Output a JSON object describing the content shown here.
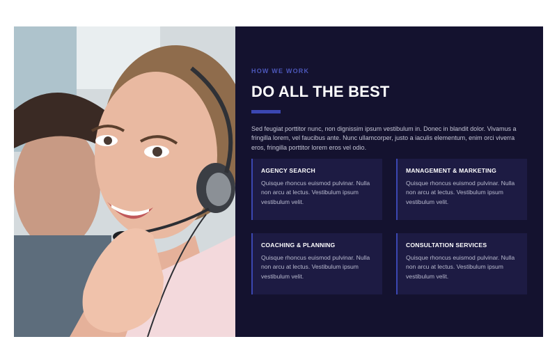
{
  "section": {
    "eyebrow": "HOW WE WORK",
    "title": "DO ALL THE BEST",
    "intro": "Sed feugiat porttitor nunc, non dignissim ipsum vestibulum in. Donec in blandit dolor. Vivamus a fringilla lorem, vel faucibus ante. Nunc ullamcorper, justo a iaculis elementum, enim orci viverra eros, fringilla porttitor lorem eros vel odio.",
    "cards": [
      {
        "title": "AGENCY SEARCH",
        "text": "Quisque rhoncus euismod pulvinar. Nulla non arcu at lectus. Vestibulum ipsum vestibulum velit."
      },
      {
        "title": "MANAGEMENT & MARKETING",
        "text": "Quisque rhoncus euismod pulvinar. Nulla non arcu at lectus. Vestibulum ipsum vestibulum velit."
      },
      {
        "title": "COACHING & PLANNING",
        "text": "Quisque rhoncus euismod pulvinar. Nulla non arcu at lectus. Vestibulum ipsum vestibulum velit."
      },
      {
        "title": "CONSULTATION SERVICES",
        "text": "Quisque rhoncus euismod pulvinar. Nulla non arcu at lectus. Vestibulum ipsum vestibulum velit."
      }
    ]
  },
  "photo": {
    "icon": "customer-support-agent-photo"
  },
  "colors": {
    "panel": "#14122f",
    "card": "#1d1b43",
    "accent": "#3b47b2",
    "eyebrow": "#4c57ba"
  }
}
